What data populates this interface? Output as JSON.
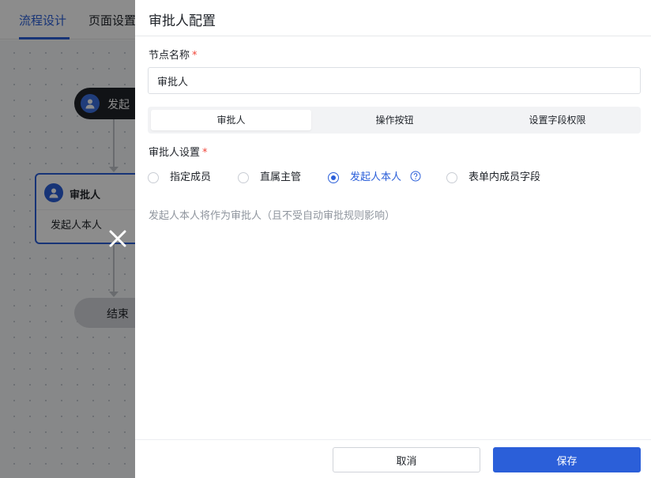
{
  "background": {
    "tabs": [
      "流程设计",
      "页面设置"
    ],
    "start_node": {
      "label": "发起"
    },
    "approver_node": {
      "title": "审批人",
      "description": "发起人本人"
    },
    "end_node": {
      "label": "结束"
    }
  },
  "drawer": {
    "title": "审批人配置",
    "node_name_label": "节点名称",
    "required_mark": "*",
    "node_name_value": "审批人",
    "tabs": [
      "审批人",
      "操作按钮",
      "设置字段权限"
    ],
    "active_tab": "审批人",
    "approver_setting_label": "审批人设置",
    "options": [
      "指定成员",
      "直属主管",
      "发起人本人",
      "表单内成员字段"
    ],
    "selected_option": "发起人本人",
    "hint": "发起人本人将作为审批人（且不受自动审批规则影响）",
    "footer": {
      "cancel": "取消",
      "save": "保存"
    }
  },
  "colors": {
    "primary": "#2b5fd9",
    "required": "#f04438",
    "hint": "#8f959e"
  },
  "icons": [
    "person-icon",
    "close-icon",
    "help-circle-icon"
  ]
}
